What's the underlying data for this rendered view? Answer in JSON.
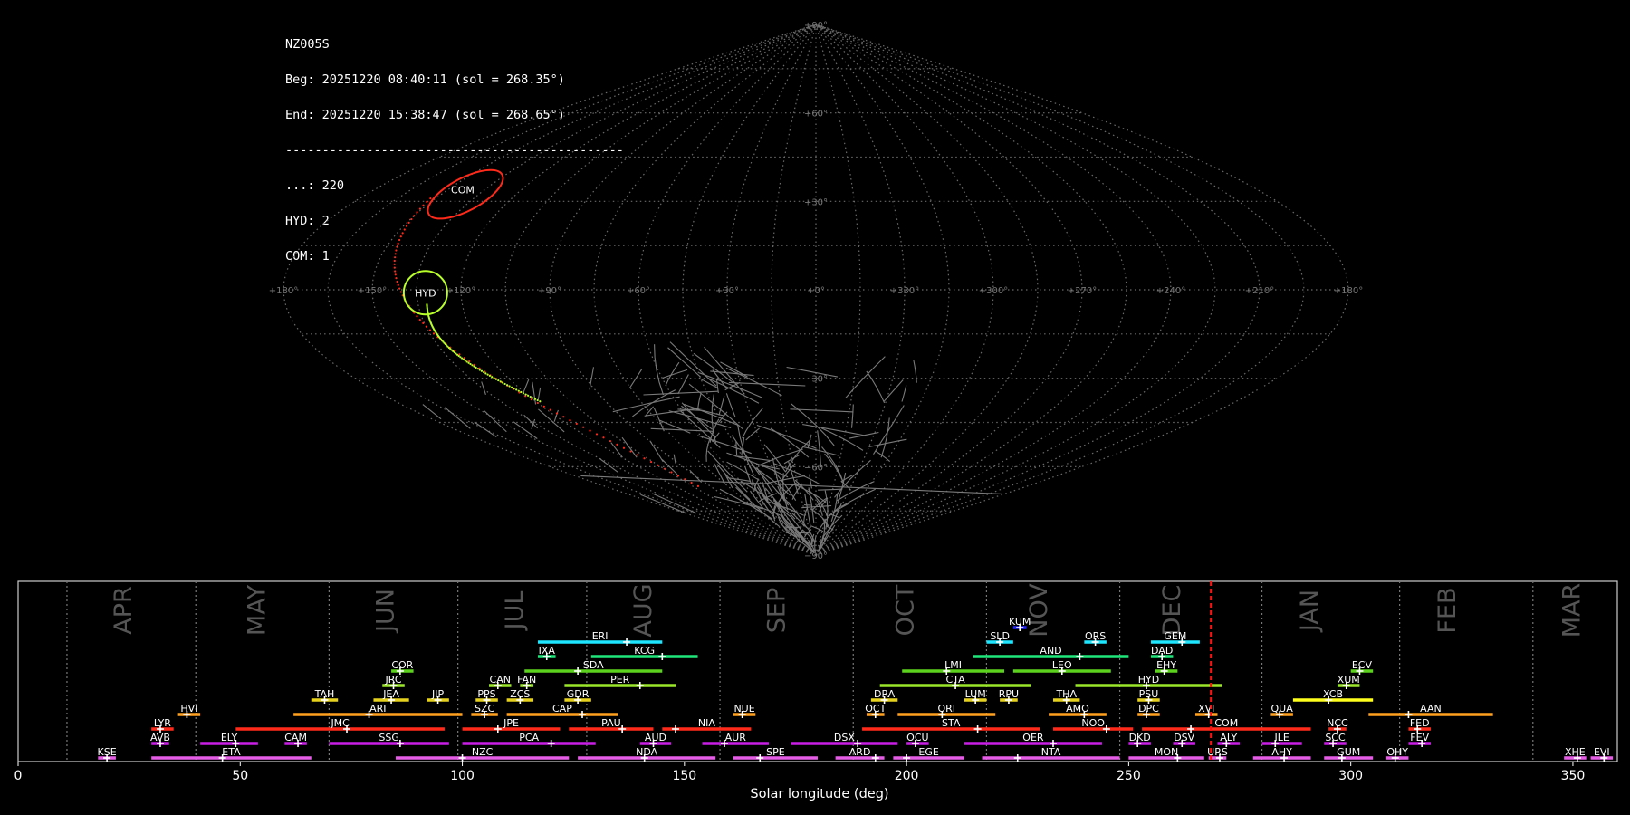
{
  "info": {
    "station": "NZ005S",
    "begin": "Beg: 20251220 08:40:11 (sol = 268.35°)",
    "end": "End: 20251220 15:38:47 (sol = 268.65°)",
    "separator": "----------------------------------------------",
    "counts": [
      "...: 220",
      "HYD: 2",
      "COM: 1"
    ]
  },
  "sky_map": {
    "projection": "sinusoidal",
    "ra_labels": [
      "+180°",
      "+150°",
      "+120°",
      "+90°",
      "+60°",
      "+30°",
      "+0°",
      "+330°",
      "+300°",
      "+270°",
      "+240°",
      "+210°",
      "+180°"
    ],
    "dec_labels": [
      "+90°",
      "+60°",
      "+30°",
      "−30°",
      "−60°",
      "−90°"
    ],
    "grid": true,
    "radiants": [
      {
        "code": "COM",
        "color": "#ff2a1a",
        "ra": 142,
        "dec": 33
      },
      {
        "code": "HYD",
        "color": "#b8ff2a",
        "ra": 132,
        "dec": -1
      }
    ]
  },
  "chart_data": {
    "type": "timeline",
    "xlabel": "Solar longitude (deg)",
    "xlim": [
      0,
      360
    ],
    "xticks": [
      0,
      50,
      100,
      150,
      200,
      250,
      300,
      350
    ],
    "current_sol": 268.5,
    "months": [
      {
        "name": "APR",
        "sol": 24
      },
      {
        "name": "MAY",
        "sol": 54
      },
      {
        "name": "JUN",
        "sol": 83
      },
      {
        "name": "JUL",
        "sol": 112
      },
      {
        "name": "AUG",
        "sol": 141
      },
      {
        "name": "SEP",
        "sol": 171
      },
      {
        "name": "OCT",
        "sol": 200
      },
      {
        "name": "NOV",
        "sol": 230
      },
      {
        "name": "DEC",
        "sol": 260
      },
      {
        "name": "JAN",
        "sol": 291
      },
      {
        "name": "FEB",
        "sol": 322
      },
      {
        "name": "MAR",
        "sol": 350
      }
    ],
    "month_boundaries": [
      11,
      40,
      70,
      99,
      128,
      158,
      188,
      218,
      248,
      280,
      311,
      341
    ],
    "showers": [
      {
        "code": "KUM",
        "start": 224,
        "end": 227,
        "peak": 225.5,
        "row": 10,
        "color": "#2424ff"
      },
      {
        "code": "ERI",
        "start": 117,
        "end": 145,
        "peak": 137,
        "row": 9,
        "color": "#1ee6ff"
      },
      {
        "code": "SLD",
        "start": 218,
        "end": 224,
        "peak": 221,
        "row": 9,
        "color": "#1ee6ff"
      },
      {
        "code": "ORS",
        "start": 240,
        "end": 245,
        "peak": 242.5,
        "row": 9,
        "color": "#1ee6ff"
      },
      {
        "code": "GEM",
        "start": 255,
        "end": 266,
        "peak": 262,
        "row": 9,
        "color": "#1ee6ff"
      },
      {
        "code": "IXA",
        "start": 117,
        "end": 121,
        "peak": 119,
        "row": 8,
        "color": "#1ee67a"
      },
      {
        "code": "KCG",
        "start": 129,
        "end": 153,
        "peak": 145,
        "row": 8,
        "color": "#1ee67a"
      },
      {
        "code": "AND",
        "start": 215,
        "end": 250,
        "peak": 239,
        "row": 8,
        "color": "#1ee67a"
      },
      {
        "code": "DAD",
        "start": 255,
        "end": 260,
        "peak": 257.5,
        "row": 8,
        "color": "#1ee67a"
      },
      {
        "code": "COR",
        "start": 84,
        "end": 89,
        "peak": 86,
        "row": 7,
        "color": "#5cd11e"
      },
      {
        "code": "SDA",
        "start": 114,
        "end": 145,
        "peak": 126,
        "row": 7,
        "color": "#5cd11e"
      },
      {
        "code": "LMI",
        "start": 199,
        "end": 222,
        "peak": 209,
        "row": 7,
        "color": "#5cd11e"
      },
      {
        "code": "LEO",
        "start": 224,
        "end": 246,
        "peak": 235,
        "row": 7,
        "color": "#5cd11e"
      },
      {
        "code": "EHY",
        "start": 256,
        "end": 261,
        "peak": 258,
        "row": 7,
        "color": "#5cd11e"
      },
      {
        "code": "ECV",
        "start": 300,
        "end": 305,
        "peak": 302,
        "row": 7,
        "color": "#5cd11e"
      },
      {
        "code": "JRC",
        "start": 82,
        "end": 87,
        "peak": 84.5,
        "row": 6,
        "color": "#9be62a"
      },
      {
        "code": "CAN",
        "start": 106,
        "end": 111,
        "peak": 108,
        "row": 6,
        "color": "#9be62a"
      },
      {
        "code": "FAN",
        "start": 113,
        "end": 116,
        "peak": 114.5,
        "row": 6,
        "color": "#9be62a"
      },
      {
        "code": "PER",
        "start": 123,
        "end": 148,
        "peak": 140,
        "row": 6,
        "color": "#9be62a"
      },
      {
        "code": "CTA",
        "start": 194,
        "end": 228,
        "peak": 211,
        "row": 6,
        "color": "#9be62a"
      },
      {
        "code": "HYD",
        "start": 238,
        "end": 271,
        "peak": 254,
        "row": 6,
        "color": "#9be62a"
      },
      {
        "code": "XUM",
        "start": 297,
        "end": 302,
        "peak": 299,
        "row": 6,
        "color": "#9be62a"
      },
      {
        "code": "TAH",
        "start": 66,
        "end": 72,
        "peak": 69,
        "row": 5,
        "color": "#e6d21e"
      },
      {
        "code": "JEA",
        "start": 80,
        "end": 88,
        "peak": 84,
        "row": 5,
        "color": "#e6d21e"
      },
      {
        "code": "JIP",
        "start": 92,
        "end": 97,
        "peak": 94.5,
        "row": 5,
        "color": "#e6d21e"
      },
      {
        "code": "PPS",
        "start": 103,
        "end": 108,
        "peak": 105.5,
        "row": 5,
        "color": "#e6d21e"
      },
      {
        "code": "ZCS",
        "start": 110,
        "end": 116,
        "peak": 113,
        "row": 5,
        "color": "#e6d21e"
      },
      {
        "code": "GDR",
        "start": 123,
        "end": 129,
        "peak": 126,
        "row": 5,
        "color": "#e6d21e"
      },
      {
        "code": "DRA",
        "start": 192,
        "end": 198,
        "peak": 195,
        "row": 5,
        "color": "#e6d21e"
      },
      {
        "code": "LUM",
        "start": 213,
        "end": 218,
        "peak": 215.5,
        "row": 5,
        "color": "#e6d21e"
      },
      {
        "code": "RPU",
        "start": 221,
        "end": 225,
        "peak": 223,
        "row": 5,
        "color": "#e6d21e"
      },
      {
        "code": "THA",
        "start": 233,
        "end": 239,
        "peak": 236,
        "row": 5,
        "color": "#e6d21e"
      },
      {
        "code": "PSU",
        "start": 252,
        "end": 257,
        "peak": 254.5,
        "row": 5,
        "color": "#e6d21e"
      },
      {
        "code": "XCB",
        "start": 287,
        "end": 305,
        "peak": 295,
        "row": 5,
        "color": "#ffff1e"
      },
      {
        "code": "HVI",
        "start": 36,
        "end": 41,
        "peak": 38,
        "row": 4,
        "color": "#ffa01e"
      },
      {
        "code": "ARI",
        "start": 62,
        "end": 100,
        "peak": 79,
        "row": 4,
        "color": "#ffa01e"
      },
      {
        "code": "SZC",
        "start": 102,
        "end": 108,
        "peak": 105,
        "row": 4,
        "color": "#ffa01e"
      },
      {
        "code": "CAP",
        "start": 110,
        "end": 135,
        "peak": 127,
        "row": 4,
        "color": "#ffa01e"
      },
      {
        "code": "NUE",
        "start": 161,
        "end": 166,
        "peak": 163,
        "row": 4,
        "color": "#ffa01e"
      },
      {
        "code": "OCT",
        "start": 191,
        "end": 195,
        "peak": 193,
        "row": 4,
        "color": "#ffa01e"
      },
      {
        "code": "ORI",
        "start": 198,
        "end": 220,
        "peak": 208,
        "row": 4,
        "color": "#ffa01e"
      },
      {
        "code": "AMO",
        "start": 232,
        "end": 245,
        "peak": 240,
        "row": 4,
        "color": "#ffa01e"
      },
      {
        "code": "DPC",
        "start": 252,
        "end": 257,
        "peak": 254,
        "row": 4,
        "color": "#ffa01e"
      },
      {
        "code": "XVI",
        "start": 265,
        "end": 270,
        "peak": 268,
        "row": 4,
        "color": "#ffa01e"
      },
      {
        "code": "QUA",
        "start": 282,
        "end": 287,
        "peak": 284,
        "row": 4,
        "color": "#ffa01e"
      },
      {
        "code": "AAN",
        "start": 304,
        "end": 332,
        "peak": 313,
        "row": 4,
        "color": "#ffa01e"
      },
      {
        "code": "LYR",
        "start": 30,
        "end": 35,
        "peak": 32,
        "row": 3,
        "color": "#ff2a1a"
      },
      {
        "code": "JMC",
        "start": 49,
        "end": 96,
        "peak": 74,
        "row": 3,
        "color": "#ff2a1a"
      },
      {
        "code": "JPE",
        "start": 100,
        "end": 122,
        "peak": 108,
        "row": 3,
        "color": "#ff2a1a"
      },
      {
        "code": "PAU",
        "start": 124,
        "end": 143,
        "peak": 136,
        "row": 3,
        "color": "#ff2a1a"
      },
      {
        "code": "NIA",
        "start": 145,
        "end": 165,
        "peak": 148,
        "row": 3,
        "color": "#ff2a1a"
      },
      {
        "code": "STA",
        "start": 190,
        "end": 230,
        "peak": 216,
        "row": 3,
        "color": "#ff2a1a"
      },
      {
        "code": "NOO",
        "start": 233,
        "end": 251,
        "peak": 245,
        "row": 3,
        "color": "#ff2a1a"
      },
      {
        "code": "COM",
        "start": 253,
        "end": 291,
        "peak": 264,
        "row": 3,
        "color": "#ff2a1a"
      },
      {
        "code": "NCC",
        "start": 295,
        "end": 299,
        "peak": 297,
        "row": 3,
        "color": "#ff2a1a"
      },
      {
        "code": "FED",
        "start": 313,
        "end": 318,
        "peak": 315,
        "row": 3,
        "color": "#ff2a1a"
      },
      {
        "code": "AVB",
        "start": 30,
        "end": 34,
        "peak": 32,
        "row": 2,
        "color": "#c81ee6"
      },
      {
        "code": "ELY",
        "start": 41,
        "end": 54,
        "peak": 49,
        "row": 2,
        "color": "#c81ee6"
      },
      {
        "code": "CAM",
        "start": 60,
        "end": 65,
        "peak": 63,
        "row": 2,
        "color": "#c81ee6"
      },
      {
        "code": "SSG",
        "start": 70,
        "end": 97,
        "peak": 86,
        "row": 2,
        "color": "#c81ee6"
      },
      {
        "code": "PCA",
        "start": 100,
        "end": 130,
        "peak": 120,
        "row": 2,
        "color": "#c81ee6"
      },
      {
        "code": "AUD",
        "start": 140,
        "end": 147,
        "peak": 143,
        "row": 2,
        "color": "#c81ee6"
      },
      {
        "code": "AUR",
        "start": 154,
        "end": 169,
        "peak": 159,
        "row": 2,
        "color": "#c81ee6"
      },
      {
        "code": "DSX",
        "start": 174,
        "end": 198,
        "peak": 189,
        "row": 2,
        "color": "#c81ee6"
      },
      {
        "code": "OCU",
        "start": 200,
        "end": 205,
        "peak": 202,
        "row": 2,
        "color": "#c81ee6"
      },
      {
        "code": "OER",
        "start": 213,
        "end": 244,
        "peak": 233,
        "row": 2,
        "color": "#c81ee6"
      },
      {
        "code": "DKD",
        "start": 250,
        "end": 255,
        "peak": 252,
        "row": 2,
        "color": "#c81ee6"
      },
      {
        "code": "DSV",
        "start": 260,
        "end": 265,
        "peak": 262,
        "row": 2,
        "color": "#c81ee6"
      },
      {
        "code": "ALY",
        "start": 270,
        "end": 275,
        "peak": 272,
        "row": 2,
        "color": "#c81ee6"
      },
      {
        "code": "ILE",
        "start": 280,
        "end": 289,
        "peak": 283,
        "row": 2,
        "color": "#c81ee6"
      },
      {
        "code": "SCC",
        "start": 294,
        "end": 299,
        "peak": 296,
        "row": 2,
        "color": "#c81ee6"
      },
      {
        "code": "FEV",
        "start": 313,
        "end": 318,
        "peak": 316,
        "row": 2,
        "color": "#c81ee6"
      },
      {
        "code": "KSE",
        "start": 18,
        "end": 22,
        "peak": 20,
        "row": 1,
        "color": "#e65ce6"
      },
      {
        "code": "ETA",
        "start": 30,
        "end": 66,
        "peak": 46,
        "row": 1,
        "color": "#e65ce6"
      },
      {
        "code": "NZC",
        "start": 85,
        "end": 124,
        "peak": 100,
        "row": 1,
        "color": "#e65ce6"
      },
      {
        "code": "NDA",
        "start": 126,
        "end": 157,
        "peak": 141,
        "row": 1,
        "color": "#e65ce6"
      },
      {
        "code": "SPE",
        "start": 161,
        "end": 180,
        "peak": 167,
        "row": 1,
        "color": "#e65ce6"
      },
      {
        "code": "ARD",
        "start": 184,
        "end": 195,
        "peak": 193,
        "row": 1,
        "color": "#e65ce6"
      },
      {
        "code": "EGE",
        "start": 197,
        "end": 213,
        "peak": 200,
        "row": 1,
        "color": "#e65ce6"
      },
      {
        "code": "NTA",
        "start": 217,
        "end": 248,
        "peak": 225,
        "row": 1,
        "color": "#e65ce6"
      },
      {
        "code": "MON",
        "start": 250,
        "end": 267,
        "peak": 261,
        "row": 1,
        "color": "#e65ce6"
      },
      {
        "code": "URS",
        "start": 268,
        "end": 272,
        "peak": 270.5,
        "row": 1,
        "color": "#e65ce6"
      },
      {
        "code": "AHY",
        "start": 278,
        "end": 291,
        "peak": 285,
        "row": 1,
        "color": "#e65ce6"
      },
      {
        "code": "GUM",
        "start": 294,
        "end": 305,
        "peak": 298,
        "row": 1,
        "color": "#e65ce6"
      },
      {
        "code": "OHY",
        "start": 308,
        "end": 313,
        "peak": 310,
        "row": 1,
        "color": "#e65ce6"
      },
      {
        "code": "XHE",
        "start": 348,
        "end": 353,
        "peak": 351,
        "row": 1,
        "color": "#e65ce6"
      },
      {
        "code": "EVI",
        "start": 354,
        "end": 359,
        "peak": 357,
        "row": 1,
        "color": "#e65ce6"
      }
    ]
  }
}
